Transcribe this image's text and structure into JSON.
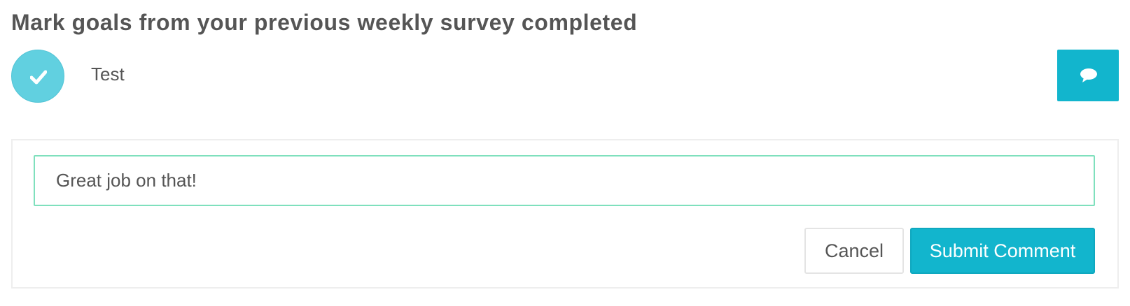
{
  "section": {
    "title": "Mark goals from your previous weekly survey completed"
  },
  "goal": {
    "name": "Test",
    "status": "completed",
    "status_icon": "check-icon",
    "comment_icon": "speech-bubble-icon"
  },
  "comment_form": {
    "input_value": "Great job on that!",
    "cancel_label": "Cancel",
    "submit_label": "Submit Comment"
  },
  "colors": {
    "accent": "#12b5cd",
    "check_circle": "#61d0e0",
    "input_focus_border": "#7fe0bd",
    "text": "#555555"
  }
}
